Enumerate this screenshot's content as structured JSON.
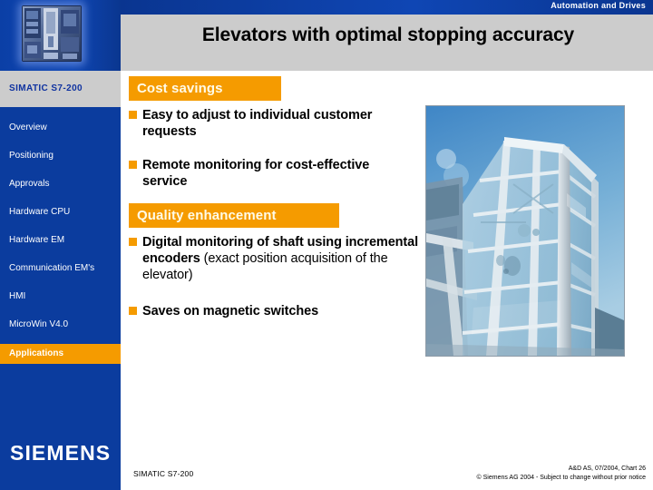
{
  "banner": {
    "division": "Automation and Drives",
    "product_image": "simatic-plc-product-photo"
  },
  "header": {
    "title": "Elevators with optimal stopping accuracy"
  },
  "sidebar": {
    "heading": "SIMATIC S7-200",
    "items": [
      {
        "label": "Overview",
        "active": false
      },
      {
        "label": "Positioning",
        "active": false
      },
      {
        "label": "Approvals",
        "active": false
      },
      {
        "label": "Hardware CPU",
        "active": false
      },
      {
        "label": "Hardware EM",
        "active": false
      },
      {
        "label": "Communication EM's",
        "active": false
      },
      {
        "label": "HMI",
        "active": false
      },
      {
        "label": "MicroWin V4.0",
        "active": false
      },
      {
        "label": "Applications",
        "active": true
      }
    ],
    "brand": "SIEMENS"
  },
  "content": {
    "sections": [
      {
        "heading": "Cost savings",
        "bullets": [
          {
            "bold": "Easy to adjust to individual customer requests",
            "normal": ""
          },
          {
            "bold": "Remote monitoring for cost-effective service",
            "normal": ""
          }
        ]
      },
      {
        "heading": "Quality enhancement",
        "bullets": [
          {
            "bold": "Digital monitoring of shaft using incremental encoders ",
            "normal": "(exact position acquisition of the elevator)"
          },
          {
            "bold": "Saves on magnetic switches",
            "normal": ""
          }
        ]
      }
    ],
    "photo_caption": "glass-elevator-shaft-photo"
  },
  "footer": {
    "left": "SIMATIC S7-200",
    "reference": "A&D AS, 07/2004, Chart 26",
    "copyright": "© Siemens AG 2004  - Subject to change without prior notice"
  },
  "colors": {
    "brand_blue": "#0b3c9e",
    "accent_orange": "#f59b00",
    "title_gray": "#cccccc"
  }
}
